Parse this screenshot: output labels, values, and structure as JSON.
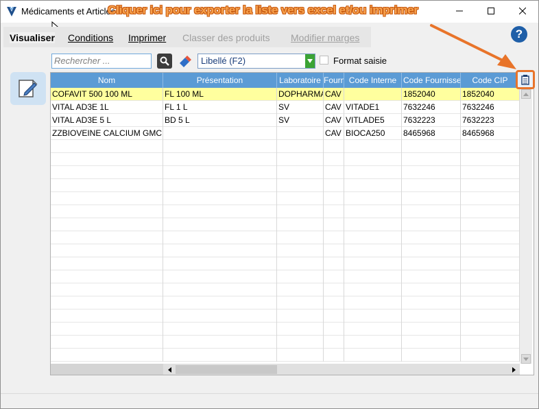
{
  "window": {
    "title": "Médicaments et Articles"
  },
  "annotation": {
    "text": "Cliquer ici pour exporter la liste vers excel et/ou imprimer",
    "color": "#f7a24e"
  },
  "tabs": [
    {
      "label": "Visualiser",
      "state": "active"
    },
    {
      "label": "Conditions",
      "state": "enabled"
    },
    {
      "label": "Imprimer",
      "state": "enabled"
    },
    {
      "label": "Classer des produits",
      "state": "disabled"
    },
    {
      "label": "Modifier marges",
      "state": "disabled"
    }
  ],
  "help": {
    "label": "?"
  },
  "toolbar": {
    "search_placeholder": "Rechercher ...",
    "search_icon": "search-icon",
    "eraser_icon": "eraser-icon",
    "sort_select_value": "Libellé (F2)",
    "format_checkbox_label": "Format saisie",
    "format_checkbox_checked": false
  },
  "grid": {
    "columns": [
      "Nom",
      "Présentation",
      "Laboratoire",
      "Fourn",
      "Code Interne",
      "Code Fournisse",
      "Code CIP"
    ],
    "rows": [
      {
        "cells": [
          "COFAVIT 500 100 ML",
          "FL 100 ML",
          "DOPHARMA",
          "CAV",
          "",
          "1852040",
          "1852040"
        ],
        "selected": true
      },
      {
        "cells": [
          "VITAL  AD3E 1L",
          "FL 1 L",
          "SV",
          "CAV",
          "VITADE1",
          "7632246",
          "7632246"
        ],
        "selected": false
      },
      {
        "cells": [
          "VITAL  AD3E 5 L",
          "BD 5  L",
          "SV",
          "CAV",
          "VITLADE5",
          "7632223",
          "7632223"
        ],
        "selected": false
      },
      {
        "cells": [
          "ZZBIOVEINE CALCIUM GMC",
          "",
          "",
          "CAV",
          "BIOCA250",
          "8465968",
          "8465968"
        ],
        "selected": false
      }
    ],
    "header_color": "#5b9bd5",
    "selected_row_color": "#ffff9e"
  },
  "export_button_icon": "export-print-icon",
  "edit_tool_icon": "edit-document-icon"
}
